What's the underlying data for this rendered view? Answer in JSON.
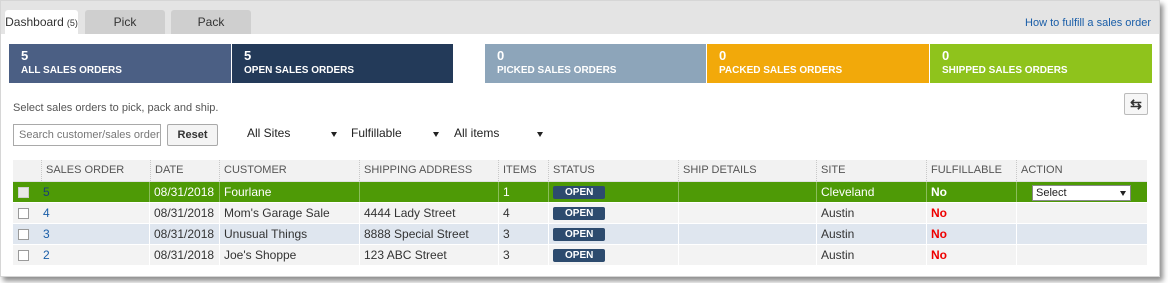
{
  "tabs": [
    {
      "label": "Dashboard",
      "count": "(5)"
    },
    {
      "label": "Pick"
    },
    {
      "label": "Pack"
    }
  ],
  "help_link": "How to fulfill a sales order",
  "tiles": [
    {
      "count": "5",
      "label": "ALL SALES ORDERS",
      "color": "#4b5f84"
    },
    {
      "count": "5",
      "label": "OPEN SALES ORDERS",
      "color": "#233a59"
    },
    {
      "count": "0",
      "label": "PICKED SALES ORDERS",
      "color": "#8da5ba"
    },
    {
      "count": "0",
      "label": "PACKED SALES ORDERS",
      "color": "#f2a90a"
    },
    {
      "count": "0",
      "label": "SHIPPED SALES ORDERS",
      "color": "#8fc31c"
    }
  ],
  "hint": "Select sales orders to pick, pack and ship.",
  "search": {
    "placeholder": "Search customer/sales order",
    "value": ""
  },
  "reset_label": "Reset",
  "filters": {
    "sites": "All Sites",
    "fulfillable": "Fulfillable",
    "items": "All items"
  },
  "columns": [
    "SALES ORDER",
    "DATE",
    "CUSTOMER",
    "SHIPPING ADDRESS",
    "ITEMS",
    "STATUS",
    "SHIP DETAILS",
    "SITE",
    "FULFILLABLE",
    "ACTION"
  ],
  "rows": [
    {
      "so": "5",
      "date": "08/31/2018",
      "customer": "Fourlane",
      "address": "",
      "items": "1",
      "status": "OPEN",
      "ship": "",
      "site": "Cleveland",
      "fulfillable": "No",
      "action": "Select"
    },
    {
      "so": "4",
      "date": "08/31/2018",
      "customer": "Mom's Garage Sale",
      "address": "4444 Lady Street",
      "items": "4",
      "status": "OPEN",
      "ship": "",
      "site": "Austin",
      "fulfillable": "No",
      "action": ""
    },
    {
      "so": "3",
      "date": "08/31/2018",
      "customer": "Unusual Things",
      "address": "8888 Special Street",
      "items": "3",
      "status": "OPEN",
      "ship": "",
      "site": "Austin",
      "fulfillable": "No",
      "action": ""
    },
    {
      "so": "2",
      "date": "08/31/2018",
      "customer": "Joe's Shoppe",
      "address": "123 ABC Street",
      "items": "3",
      "status": "OPEN",
      "ship": "",
      "site": "Austin",
      "fulfillable": "No",
      "action": ""
    }
  ],
  "colors": {
    "selected_row": "#4e9a06",
    "status_badge": "#2d4b6e",
    "no_text": "#e00000",
    "link": "#1a5ea8"
  }
}
